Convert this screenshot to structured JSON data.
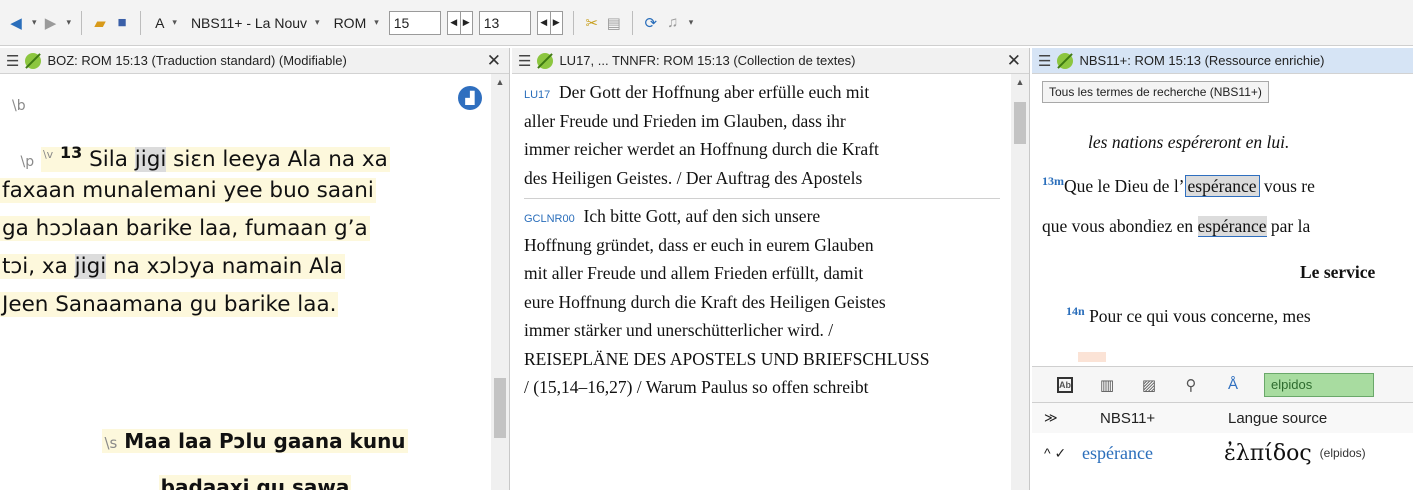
{
  "toolbar": {
    "back_icon": "arrow-left",
    "forward_icon": "arrow-right",
    "font_label": "A",
    "project": "NBS11+ - La Nouv",
    "book": "ROM",
    "chapter": "15",
    "verse": "13"
  },
  "pane1": {
    "title": "BOZ: ROM 15:13 (Traduction standard) (Modifiable)",
    "close": "✕",
    "marker_b": "\\b",
    "marker_p": "\\p",
    "marker_v": "\\v",
    "verse_num": "13",
    "line1_a": "Sila ",
    "line1_jigi": "jigi",
    "line1_b": " siɛn leeya Ala na xa",
    "line2": "faxaan munalemani yee buo saani",
    "line3": "ga hɔɔlaan barike laa, fumaan g’a",
    "line4_a": "tɔi, xa ",
    "line4_jigi": "jigi",
    "line4_b": " na xɔlɔya namain Ala",
    "line5": "Jeen Sanaamana gu barike laa.",
    "marker_s": "\\s",
    "heading_1": "Maa laa Pɔlu gaana kunu",
    "heading_2": "badaaxi gu sawa"
  },
  "pane2": {
    "title": "LU17, ... TNNFR: ROM 15:13 (Collection de textes)",
    "close": "✕",
    "entry1_abbr": "LU17",
    "entry1_lines": [
      "Der Gott der Hoffnung aber erfülle euch mit",
      "aller Freude und Frieden im Glauben, dass ihr",
      "immer reicher werdet an Hoffnung durch die Kraft",
      "des Heiligen Geistes. / Der Auftrag des Apostels"
    ],
    "entry2_abbr": "GCLNR00",
    "entry2_lines": [
      "Ich bitte Gott, auf den sich unsere",
      "Hoffnung gründet, dass er euch in eurem Glauben",
      "mit aller Freude und allem Frieden erfüllt, damit",
      "eure Hoffnung durch die Kraft des Heiligen Geistes",
      "immer stärker und unerschütterlicher wird. /",
      "REISEPLÄNE DES APOSTELS UND BRIEFSCHLUSS",
      "/ (15,14–16,27) / Warum Paulus so offen schreibt"
    ]
  },
  "pane3": {
    "title": "NBS11+: ROM 15:13 (Ressource enrichie)",
    "filter_button": "Tous les termes de recherche (NBS11+)",
    "line1": "les nations espéreront en lui.",
    "line2_num": "13m",
    "line2_a": "Que le Dieu de l’",
    "line2_sel": "espérance",
    "line2_b": " vous re",
    "line3_a": "que vous abondiez en ",
    "line3_hl": "espérance",
    "line3_b": " par la",
    "line4": "Le service",
    "line5_num": "14n",
    "line5": " Pour ce qui vous concerne, mes",
    "search_value": "elpidos",
    "col1": "NBS11+",
    "col2": "Langue source",
    "row_term": "espérance",
    "row_greek": "ἐλπίδος",
    "row_translit": "(elpidos)"
  }
}
